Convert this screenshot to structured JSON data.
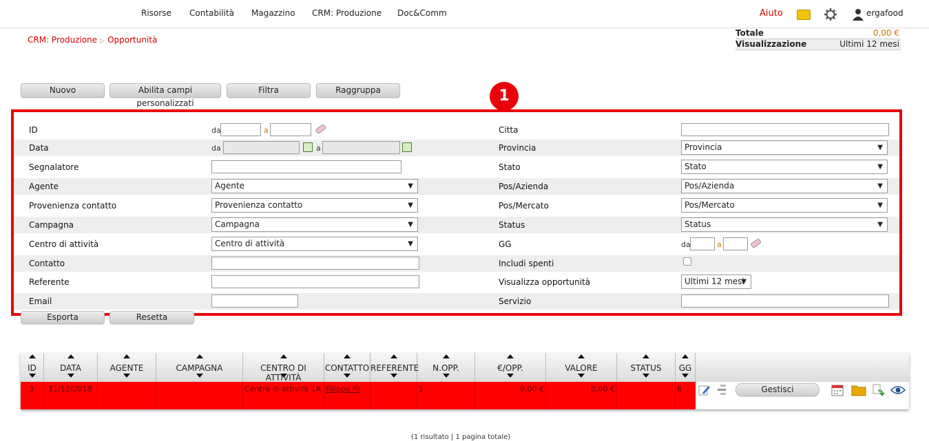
{
  "nav": {
    "items": [
      "Risorse",
      "Contabilità",
      "Magazzino",
      "CRM: Produzione",
      "Doc&Comm"
    ],
    "help": "Aiuto",
    "user": "ergafood"
  },
  "breadcrumb": {
    "section": "CRM: Produzione",
    "page": "Opportunità",
    "sep": "▷"
  },
  "totals": {
    "totale_label": "Totale",
    "totale_value": "0,00 €",
    "vis_label": "Visualizzazione",
    "vis_value": "Ultimi 12 mesi"
  },
  "toolbar": {
    "nuovo": "Nuovo",
    "abilita": "Abilita campi personalizzati",
    "filtra": "Filtra",
    "raggruppa": "Raggruppa",
    "esporta": "Esporta",
    "resetta": "Resetta"
  },
  "badge": "1",
  "filters": {
    "da": "da",
    "a": "a",
    "left": {
      "id": "ID",
      "data": "Data",
      "segnalatore": "Segnalatore",
      "agente": "Agente",
      "agente_sel": "Agente",
      "provenienza": "Provenienza contatto",
      "provenienza_sel": "Provenienza contatto",
      "campagna": "Campagna",
      "campagna_sel": "Campagna",
      "centro": "Centro di attività",
      "centro_sel": "Centro di attività",
      "contatto": "Contatto",
      "referente": "Referente",
      "email": "Email"
    },
    "right": {
      "citta": "Citta",
      "provincia": "Provincia",
      "provincia_sel": "Provincia",
      "stato": "Stato",
      "stato_sel": "Stato",
      "pos_azienda": "Pos/Azienda",
      "pos_azienda_sel": "Pos/Azienda",
      "pos_mercato": "Pos/Mercato",
      "pos_mercato_sel": "Pos/Mercato",
      "status": "Status",
      "status_sel": "Status",
      "gg": "GG",
      "includi": "Includi spenti",
      "visualizza": "Visualizza opportunità",
      "visualizza_sel": "Ultimi 12 mesi",
      "servizio": "Servizio"
    }
  },
  "table": {
    "headers": [
      "ID",
      "DATA",
      "AGENTE",
      "CAMPAGNA",
      "CENTRO DI ATTIVITÀ",
      "CONTATTO",
      "REFERENTE",
      "N.OPP.",
      "€/OPP.",
      "VALORE",
      "STATUS",
      "GG"
    ],
    "row": {
      "id": "3",
      "data": "11/12/2018",
      "agente": "",
      "campagna": "",
      "centro": "Centro di attività 1A",
      "contatto": "Filippo Fil",
      "referente": "",
      "nopp": "1",
      "eopp": "0,00 €",
      "valore": "0,00 €",
      "status": "",
      "gg": "6",
      "gestisci": "Gestisci"
    }
  },
  "footer": "(1 risultato | 1 pagina totale)",
  "colors": {
    "accent": "#d40000",
    "highlight": "#ff0000",
    "border": "#e8000b"
  }
}
